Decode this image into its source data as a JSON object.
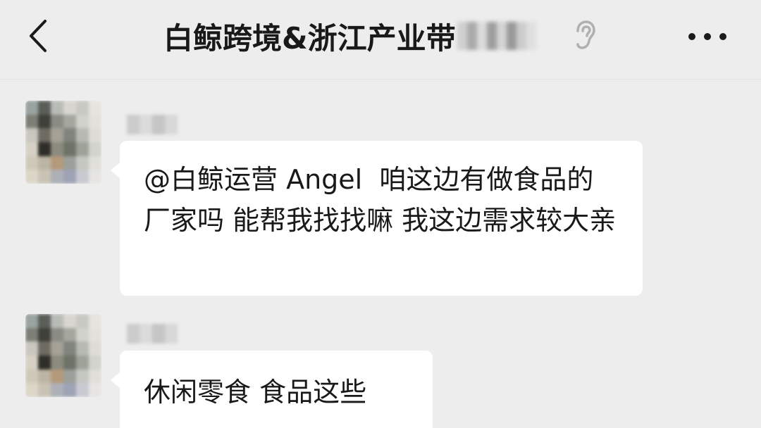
{
  "header": {
    "back_icon": "chevron-left-icon",
    "title": "白鲸跨境&浙江产业带",
    "title_obscured": true,
    "mute_icon": "ear-icon",
    "more_icon": "more-dots-icon"
  },
  "messages": [
    {
      "sender_obscured": true,
      "avatar_obscured": true,
      "text": "@白鲸运营 Angel  咱这边有做食品的厂家吗 能帮我找找嘛 我这边需求较大亲"
    },
    {
      "sender_obscured": true,
      "avatar_obscured": true,
      "text": "休闲零食 食品这些"
    }
  ],
  "colors": {
    "background": "#ededed",
    "bubble": "#ffffff",
    "text": "#191919"
  }
}
